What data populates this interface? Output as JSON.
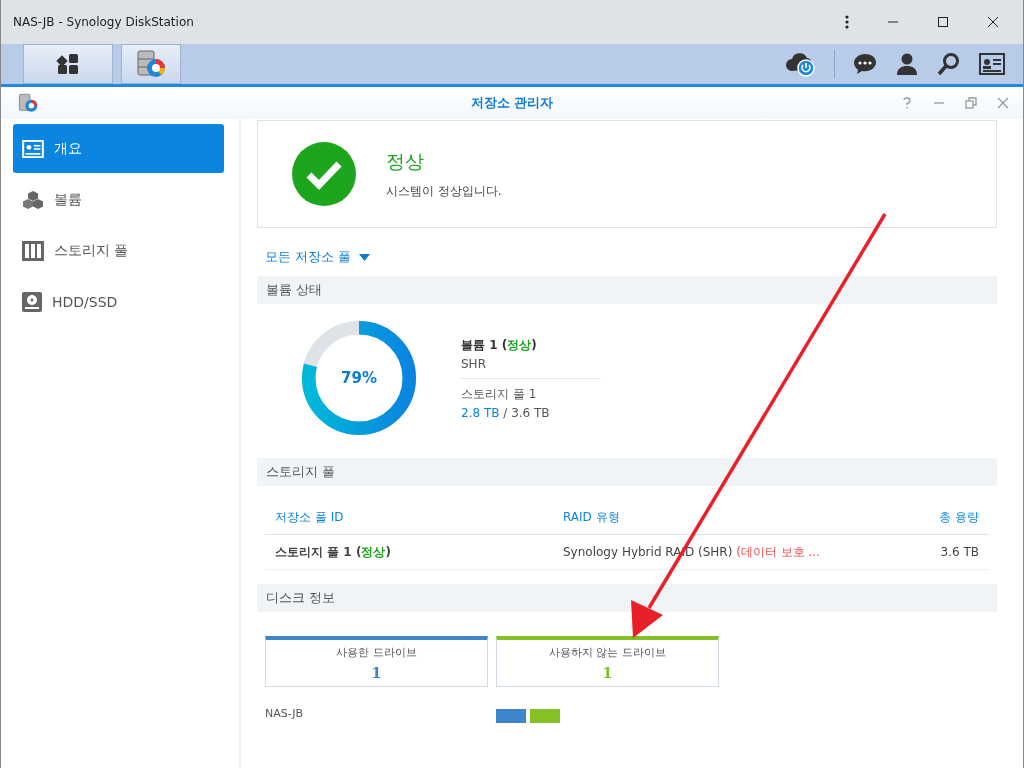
{
  "window": {
    "title": "NAS-JB - Synology DiskStation"
  },
  "app": {
    "title": "저장소 관리자"
  },
  "sidebar": {
    "items": [
      {
        "label": "개요",
        "selected": true
      },
      {
        "label": "볼륨",
        "selected": false
      },
      {
        "label": "스토리지 풀",
        "selected": false
      },
      {
        "label": "HDD/SSD",
        "selected": false
      }
    ]
  },
  "status": {
    "title": "정상",
    "message": "시스템이 정상입니다."
  },
  "filter": {
    "label": "모든 저장소 풀"
  },
  "volume_status": {
    "heading": "볼륨 상태",
    "level": 0.79,
    "percent": "79%",
    "name_parts": [
      {
        "text": "볼륨 1 ("
      },
      {
        "text": "정상",
        "kind": "ok"
      },
      {
        "text": ")"
      }
    ],
    "type": "SHR",
    "pool": "스토리지 풀 1",
    "usage_parts": [
      {
        "text": "2.8 TB",
        "kind": "used"
      },
      {
        "text": " / 3.6 TB"
      }
    ]
  },
  "storage_pools": {
    "heading": "스토리지 풀",
    "columns": [
      "저장소 풀 ID",
      "RAID 유형",
      "총 용량"
    ],
    "rows": [
      {
        "id_parts": [
          {
            "text": "스토리지 풀 1 ("
          },
          {
            "text": "정상",
            "kind": "ok"
          },
          {
            "text": ")"
          }
        ],
        "raid_parts": [
          {
            "text": "Synology Hybrid RAID (SHR) "
          },
          {
            "text": "(데이터 보호 ...",
            "kind": "warning"
          }
        ],
        "capacity": "3.6 TB"
      }
    ]
  },
  "disk_info": {
    "heading": "디스크 정보",
    "cards": [
      {
        "label": "사용한 드라이브",
        "count": "1",
        "color": "#3d86cc"
      },
      {
        "label": "사용하지 않는 드라이브",
        "count": "1",
        "color": "#84c126"
      }
    ],
    "host": "NAS-JB"
  }
}
